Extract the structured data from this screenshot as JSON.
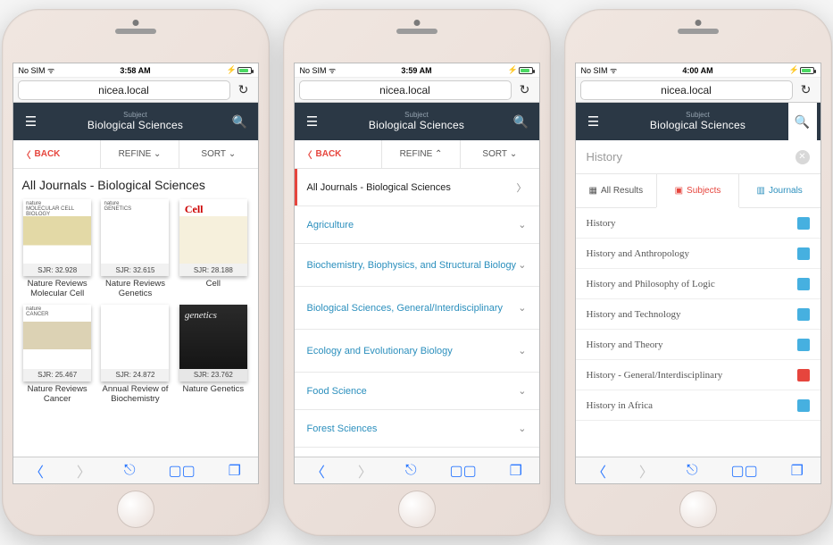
{
  "status": {
    "carrier": "No SIM",
    "wifi": "ᯤ"
  },
  "times": [
    "3:58 AM",
    "3:59 AM",
    "4:00 AM"
  ],
  "url": "nicea.local",
  "header": {
    "super": "Subject",
    "title": "Biological Sciences"
  },
  "controls": {
    "back": "BACK",
    "refine": "REFINE",
    "sort": "SORT"
  },
  "screen1": {
    "page_title": "All Journals - Biological Sciences",
    "journals": [
      {
        "name": "Nature Reviews Molecular Cell",
        "sjr": "SJR: 32.928",
        "cv": "cv1",
        "top": "nature\\nMOLECULAR CELL BIOLOGY"
      },
      {
        "name": "Nature Reviews Genetics",
        "sjr": "SJR: 32.615",
        "cv": "cv2",
        "top": "nature\\nGENETICS"
      },
      {
        "name": "Cell",
        "sjr": "SJR: 28.188",
        "cv": "cv3",
        "top": ""
      },
      {
        "name": "Nature Reviews Cancer",
        "sjr": "SJR: 25.467",
        "cv": "cv4",
        "top": "nature\\nCANCER"
      },
      {
        "name": "Annual Review of Biochemistry",
        "sjr": "SJR: 24.872",
        "cv": "cv5",
        "top": ""
      },
      {
        "name": "Nature Genetics",
        "sjr": "SJR: 23.762",
        "cv": "cv6",
        "top": ""
      }
    ]
  },
  "screen2": {
    "first_row": "All Journals - Biological Sciences",
    "categories": [
      "Agriculture",
      "Biochemistry, Biophysics, and Structural Biology",
      "Biological Sciences, General/Interdisciplinary",
      "Ecology and Evolutionary Biology",
      "Food Science",
      "Forest Sciences"
    ]
  },
  "screen3": {
    "query": "History",
    "tabs": {
      "all": "All Results",
      "subjects": "Subjects",
      "journals": "Journals"
    },
    "results": [
      {
        "label": "History",
        "color": "blue"
      },
      {
        "label": "History and Anthropology",
        "color": "blue"
      },
      {
        "label": "History and Philosophy of Logic",
        "color": "blue"
      },
      {
        "label": "History and Technology",
        "color": "blue"
      },
      {
        "label": "History and Theory",
        "color": "blue"
      },
      {
        "label": "History - General/Interdisciplinary",
        "color": "red"
      },
      {
        "label": "History in Africa",
        "color": "blue"
      }
    ]
  }
}
